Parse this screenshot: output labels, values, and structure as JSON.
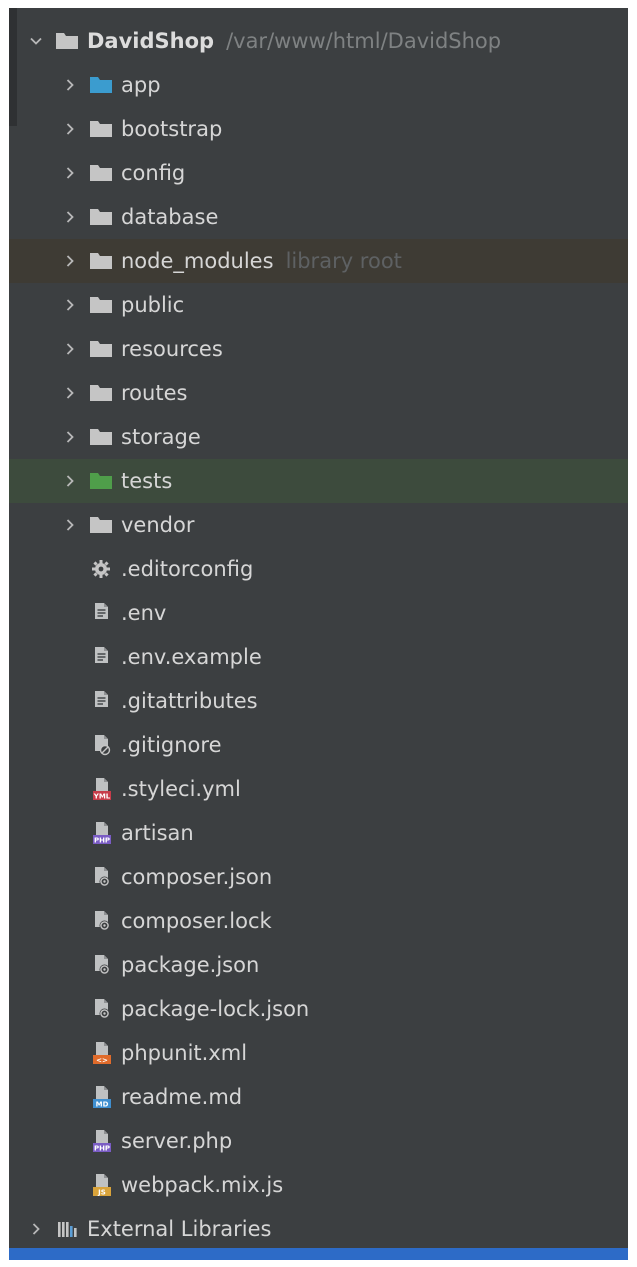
{
  "project": {
    "name": "DavidShop",
    "path": "/var/www/html/DavidShop"
  },
  "folders": [
    {
      "name": "app",
      "icon": "module-folder-icon",
      "color": "#3b9ccf"
    },
    {
      "name": "bootstrap",
      "icon": "folder-icon",
      "color": "#c5c5c5"
    },
    {
      "name": "config",
      "icon": "folder-icon",
      "color": "#c5c5c5"
    },
    {
      "name": "database",
      "icon": "folder-icon",
      "color": "#c5c5c5"
    },
    {
      "name": "node_modules",
      "hint": "library root",
      "icon": "folder-icon",
      "color": "#c5c5c5"
    },
    {
      "name": "public",
      "icon": "folder-icon",
      "color": "#c5c5c5"
    },
    {
      "name": "resources",
      "icon": "folder-icon",
      "color": "#c5c5c5"
    },
    {
      "name": "routes",
      "icon": "folder-icon",
      "color": "#c5c5c5"
    },
    {
      "name": "storage",
      "icon": "folder-icon",
      "color": "#c5c5c5"
    },
    {
      "name": "tests",
      "icon": "test-folder-icon",
      "color": "#4f9e4a"
    },
    {
      "name": "vendor",
      "icon": "folder-icon",
      "color": "#c5c5c5"
    }
  ],
  "files": [
    {
      "name": ".editorconfig",
      "icon": "gear-icon"
    },
    {
      "name": ".env",
      "icon": "text-file-icon"
    },
    {
      "name": ".env.example",
      "icon": "text-file-icon"
    },
    {
      "name": ".gitattributes",
      "icon": "text-file-icon"
    },
    {
      "name": ".gitignore",
      "icon": "ignore-file-icon"
    },
    {
      "name": ".styleci.yml",
      "icon": "yaml-file-icon",
      "badge": "YML",
      "badge_color": "#c63c4a"
    },
    {
      "name": "artisan",
      "icon": "php-file-icon",
      "badge": "PHP",
      "badge_color": "#7a5cc4"
    },
    {
      "name": "composer.json",
      "icon": "json-file-icon"
    },
    {
      "name": "composer.lock",
      "icon": "json-file-icon"
    },
    {
      "name": "package.json",
      "icon": "json-file-icon"
    },
    {
      "name": "package-lock.json",
      "icon": "json-file-icon"
    },
    {
      "name": "phpunit.xml",
      "icon": "xml-file-icon",
      "badge": "<>",
      "badge_color": "#e06b2b"
    },
    {
      "name": "readme.md",
      "icon": "markdown-file-icon",
      "badge": "MD",
      "badge_color": "#3f8fd0"
    },
    {
      "name": "server.php",
      "icon": "php-file-icon",
      "badge": "PHP",
      "badge_color": "#7a5cc4"
    },
    {
      "name": "webpack.mix.js",
      "icon": "js-file-icon",
      "badge": "JS",
      "badge_color": "#d9a33a"
    }
  ],
  "external": {
    "name": "External Libraries",
    "icon": "library-icon"
  },
  "colors": {
    "panel_bg": "#3c3f41",
    "excluded_row_bg": "#3e3b34",
    "test_row_bg": "#3d4b3d",
    "selection_bar": "#2d6bc7"
  }
}
